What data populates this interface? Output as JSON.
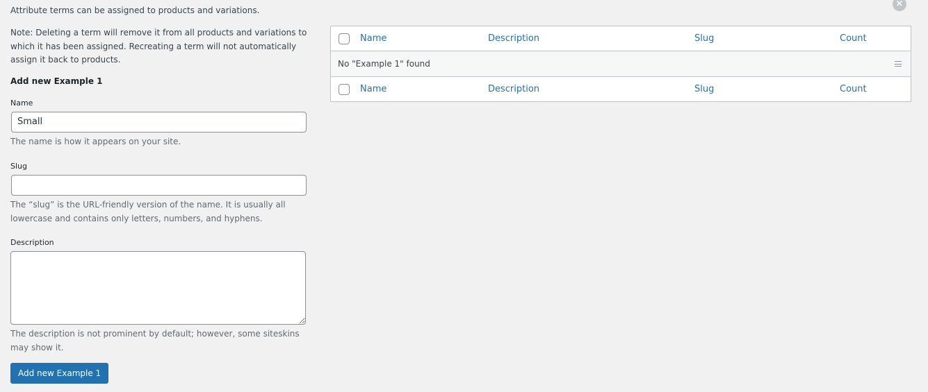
{
  "intro_text": "Attribute terms can be assigned to products and variations.",
  "close_icon_glyph": "×",
  "note_text": "Note: Deleting a term will remove it from all products and variations to which it has been assigned. Recreating a term will not automatically assign it back to products.",
  "form": {
    "title": "Add new Example 1",
    "name": {
      "label": "Name",
      "value": "Small",
      "hint": "The name is how it appears on your site."
    },
    "slug": {
      "label": "Slug",
      "value": "",
      "hint": "The “slug” is the URL-friendly version of the name. It is usually all lowercase and contains only letters, numbers, and hyphens."
    },
    "description": {
      "label": "Description",
      "value": "",
      "hint": "The description is not prominent by default; however, some siteskins may show it."
    },
    "submit_label": "Add new Example 1"
  },
  "table": {
    "columns": [
      "Name",
      "Description",
      "Slug",
      "Count"
    ],
    "empty_message": "No \"Example 1\" found"
  },
  "icons": {
    "close": "close-icon",
    "row_menu": "menu-lines-icon"
  },
  "colors": {
    "primary": "#2271b1",
    "background": "#f1f1f1",
    "text": "#3c434a"
  }
}
